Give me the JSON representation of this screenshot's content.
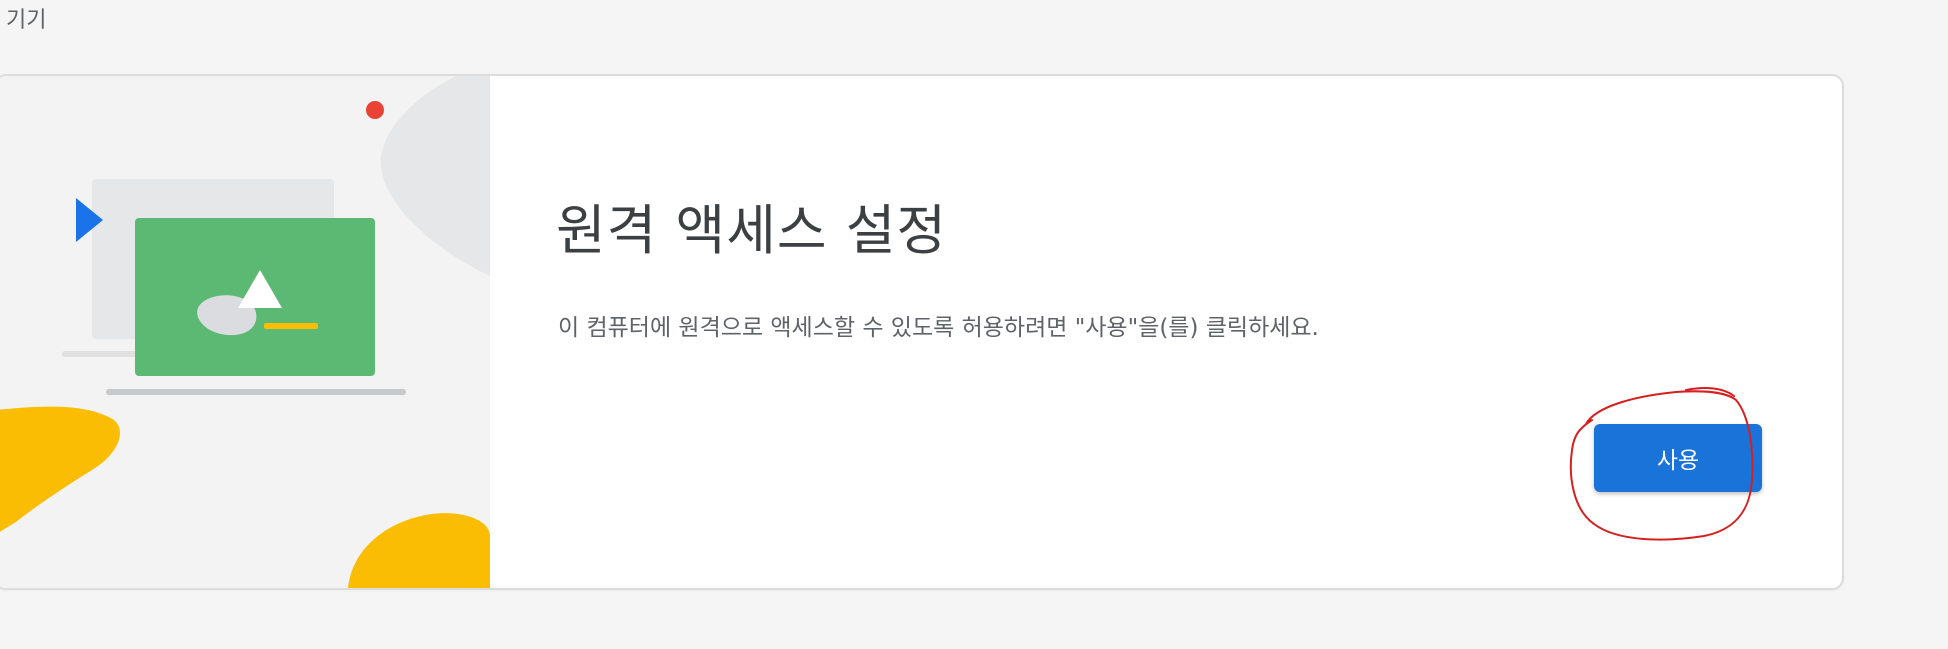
{
  "section": {
    "label": "기기"
  },
  "remote_access_card": {
    "title": "원격 액세스 설정",
    "description": "이 컴퓨터에 원격으로 액세스할 수 있도록 허용하려면 \"사용\"을(를) 클릭하세요.",
    "enable_button_label": "사용"
  },
  "colors": {
    "page_background": "#f5f5f5",
    "card_background": "#ffffff",
    "illustration_background": "#f3f3f3",
    "button_primary": "#1a73d9",
    "monitor_screen": "#5bb974",
    "arrow_blue": "#1a73e8",
    "dot_red": "#ea4335",
    "blob_yellow": "#fbbc04",
    "annotation_red": "#d62020"
  },
  "icons": {
    "illustration": "remote-desktop-illustration",
    "annotation": "hand-drawn-circle"
  }
}
